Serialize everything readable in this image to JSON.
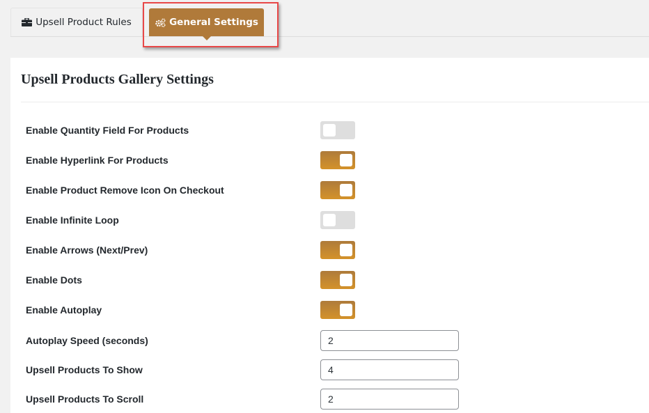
{
  "tabs": [
    {
      "label": "Upsell Product Rules",
      "icon": "briefcase-icon",
      "active": false
    },
    {
      "label": "General Settings",
      "icon": "gears-icon",
      "active": true
    }
  ],
  "colors": {
    "accent": "#b07a3a",
    "toggle_on_top": "#ae7b3b",
    "toggle_on_bottom": "#d4922a",
    "toggle_off": "#dedede",
    "highlight": "#e84848"
  },
  "panel": {
    "title": "Upsell Products Gallery Settings"
  },
  "settings": [
    {
      "label": "Enable Quantity Field For Products",
      "type": "toggle",
      "enabled": false
    },
    {
      "label": "Enable Hyperlink For Products",
      "type": "toggle",
      "enabled": true
    },
    {
      "label": "Enable Product Remove Icon On Checkout",
      "type": "toggle",
      "enabled": true
    },
    {
      "label": "Enable Infinite Loop",
      "type": "toggle",
      "enabled": false
    },
    {
      "label": "Enable Arrows (Next/Prev)",
      "type": "toggle",
      "enabled": true
    },
    {
      "label": "Enable Dots",
      "type": "toggle",
      "enabled": true
    },
    {
      "label": "Enable Autoplay",
      "type": "toggle",
      "enabled": true
    },
    {
      "label": "Autoplay Speed (seconds)",
      "type": "number",
      "value": "2"
    },
    {
      "label": "Upsell Products To Show",
      "type": "number",
      "value": "4"
    },
    {
      "label": "Upsell Products To Scroll",
      "type": "number",
      "value": "2"
    }
  ]
}
